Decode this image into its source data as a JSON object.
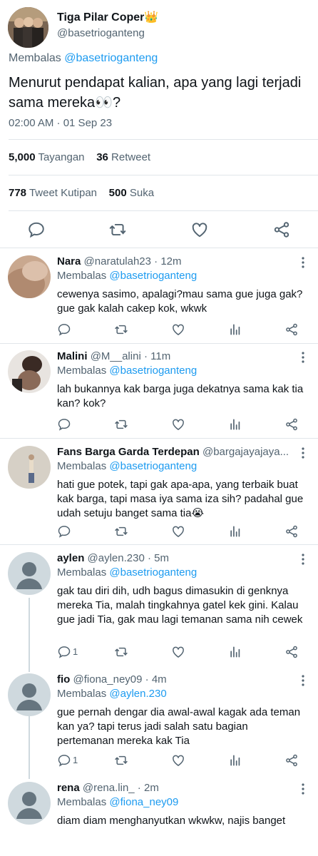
{
  "colors": {
    "accent": "#1d9bf0",
    "secondary_text": "#536471",
    "divider": "#e1e6ea"
  },
  "tweet": {
    "author_name": "Tiga Pilar Coper",
    "author_badge": "👑",
    "author_handle": "@basetrioganteng",
    "reply_prefix": "Membalas",
    "reply_to": "@basetrioganteng",
    "text": "Menurut pendapat kalian, apa yang lagi terjadi sama mereka👀?",
    "timestamp": "02:00 AM · 01 Sep 23",
    "views_count": "5,000",
    "views_label": "Tayangan",
    "retweets_count": "36",
    "retweets_label": "Retweet",
    "quotes_count": "778",
    "quotes_label": "Tweet Kutipan",
    "likes_count": "500",
    "likes_label": "Suka"
  },
  "replies": [
    {
      "name": "Nara",
      "handle": "@naratulah23",
      "time": "12m",
      "reply_prefix": "Membalas",
      "reply_to": "@basetrioganteng",
      "text": "cewenya sasimo, apalagi?mau sama gue juga gak? gue gak kalah cakep kok, wkwk",
      "reply_count": ""
    },
    {
      "name": "Malini",
      "handle": "@M__alini",
      "time": "11m",
      "reply_prefix": "Membalas",
      "reply_to": "@basetrioganteng",
      "text": "lah bukannya kak barga juga dekatnya sama kak tia kan? kok?",
      "reply_count": ""
    },
    {
      "name": "Fans Barga Garda Terdepan",
      "handle": "@bargajayajaya...",
      "time": "",
      "reply_prefix": "Membalas",
      "reply_to": "@basetrioganteng",
      "text": "hati gue potek, tapi gak apa-apa, yang terbaik buat kak barga, tapi masa iya sama iza sih? padahal gue udah setuju banget sama tia😭",
      "reply_count": ""
    },
    {
      "name": "aylen",
      "handle": "@aylen.230",
      "time": "5m",
      "reply_prefix": "Membalas",
      "reply_to": "@basetrioganteng",
      "text": "gak tau diri dih, udh bagus dimasukin di genknya mereka Tia, malah tingkahnya gatel kek gini. Kalau gue jadi Tia, gak mau lagi temanan sama nih cewek",
      "reply_count": "1"
    },
    {
      "name": "fio",
      "handle": "@fiona_ney09",
      "time": "4m",
      "reply_prefix": "Membalas",
      "reply_to": "@aylen.230",
      "text": "gue pernah dengar dia awal-awal kagak ada teman kan ya? tapi terus jadi salah satu bagian pertemanan mereka kak Tia",
      "reply_count": "1"
    },
    {
      "name": "rena",
      "handle": "@rena.lin_",
      "time": "2m",
      "reply_prefix": "Membalas",
      "reply_to": "@fiona_ney09",
      "text": "diam diam menghanyutkan wkwkw, najis banget",
      "reply_count": ""
    }
  ]
}
